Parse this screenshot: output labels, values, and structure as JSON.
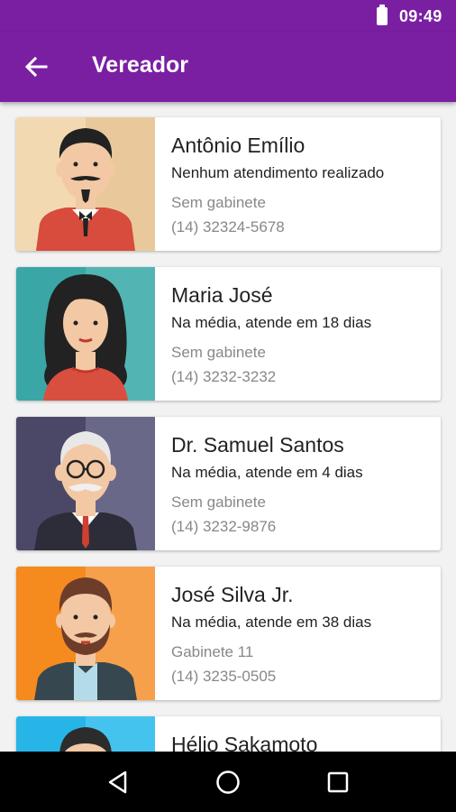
{
  "status_bar": {
    "time": "09:49",
    "battery_icon": "battery-full-icon"
  },
  "app_bar": {
    "title": "Vereador",
    "back_icon": "arrow-back-icon"
  },
  "councillors": [
    {
      "name": "Antônio Emílio",
      "attendance": "Nenhum atendimento realizado",
      "office": "Sem gabinete",
      "phone": "(14) 32324-5678",
      "photo_bg": "#f3d9b1",
      "avatar": "man-with-goatee-red-suit"
    },
    {
      "name": "Maria José",
      "attendance": "Na média, atende em 18 dias",
      "office": "Sem gabinete",
      "phone": "(14) 3232-3232",
      "photo_bg": "#3aa6a6",
      "avatar": "woman-curly-hair"
    },
    {
      "name": "Dr. Samuel Santos",
      "attendance": "Na média, atende em 4 dias",
      "office": "Sem gabinete",
      "phone": "(14) 3232-9876",
      "photo_bg": "#4a4866",
      "avatar": "old-man-glasses-mustache"
    },
    {
      "name": "José Silva Jr.",
      "attendance": "Na média, atende em 38 dias",
      "office": "Gabinete 11",
      "phone": "(14) 3235-0505",
      "photo_bg": "#f58a1f",
      "avatar": "man-with-beard"
    },
    {
      "name": "Hélio Sakamoto",
      "attendance": "",
      "office": "",
      "phone": "",
      "photo_bg": "#27b5e8",
      "avatar": "man-dark-hair"
    }
  ],
  "nav_bar": {
    "back": "nav-back-icon",
    "home": "nav-home-icon",
    "recents": "nav-recents-icon"
  }
}
